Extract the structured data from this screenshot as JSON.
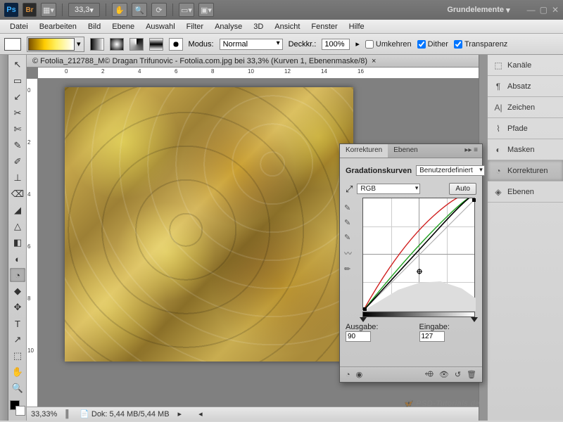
{
  "app": {
    "ps": "Ps",
    "br": "Br",
    "zoom": "33,3",
    "workspace": "Grundelemente"
  },
  "menu": [
    "Datei",
    "Bearbeiten",
    "Bild",
    "Ebene",
    "Auswahl",
    "Filter",
    "Analyse",
    "3D",
    "Ansicht",
    "Fenster",
    "Hilfe"
  ],
  "options": {
    "modus_label": "Modus:",
    "modus_value": "Normal",
    "deckkr_label": "Deckkr.:",
    "deckkr_value": "100%",
    "umkehren": "Umkehren",
    "dither": "Dither",
    "transparenz": "Transparenz"
  },
  "document": {
    "tab_title": "© Fotolia_212788_M© Dragan Trifunovic - Fotolia.com.jpg bei 33,3% (Kurven 1, Ebenenmaske/8)",
    "ruler_marks": [
      "0",
      "2",
      "4",
      "6",
      "8",
      "10",
      "12",
      "14",
      "16"
    ],
    "ruler_v": [
      "0",
      "2",
      "4",
      "6",
      "8",
      "10"
    ]
  },
  "status": {
    "zoom": "33,33%",
    "doc": "Dok: 5,44 MB/5,44 MB"
  },
  "right_panels": [
    "Kanäle",
    "Absatz",
    "Zeichen",
    "Pfade",
    "Masken",
    "Korrekturen",
    "Ebenen"
  ],
  "right_icons": [
    "⬚",
    "¶",
    "A|",
    "⌇",
    "◐",
    "◔",
    "◈"
  ],
  "curves": {
    "tab1": "Korrekturen",
    "tab2": "Ebenen",
    "title": "Gradationskurven",
    "preset": "Benutzerdefiniert",
    "channel": "RGB",
    "auto": "Auto",
    "ausgabe_label": "Ausgabe:",
    "ausgabe_value": "90",
    "eingabe_label": "Eingabe:",
    "eingabe_value": "127"
  },
  "tools": [
    "↖",
    "▭",
    "↙",
    "✂",
    "✄",
    "✎",
    "✐",
    "⊥",
    "⌫",
    "◢",
    "△",
    "◧",
    "◐",
    "◔",
    "◆",
    "✥",
    "T",
    "↗",
    "⬚",
    "✋",
    "🔍"
  ],
  "watermark": "PSD-Tutorials.de"
}
